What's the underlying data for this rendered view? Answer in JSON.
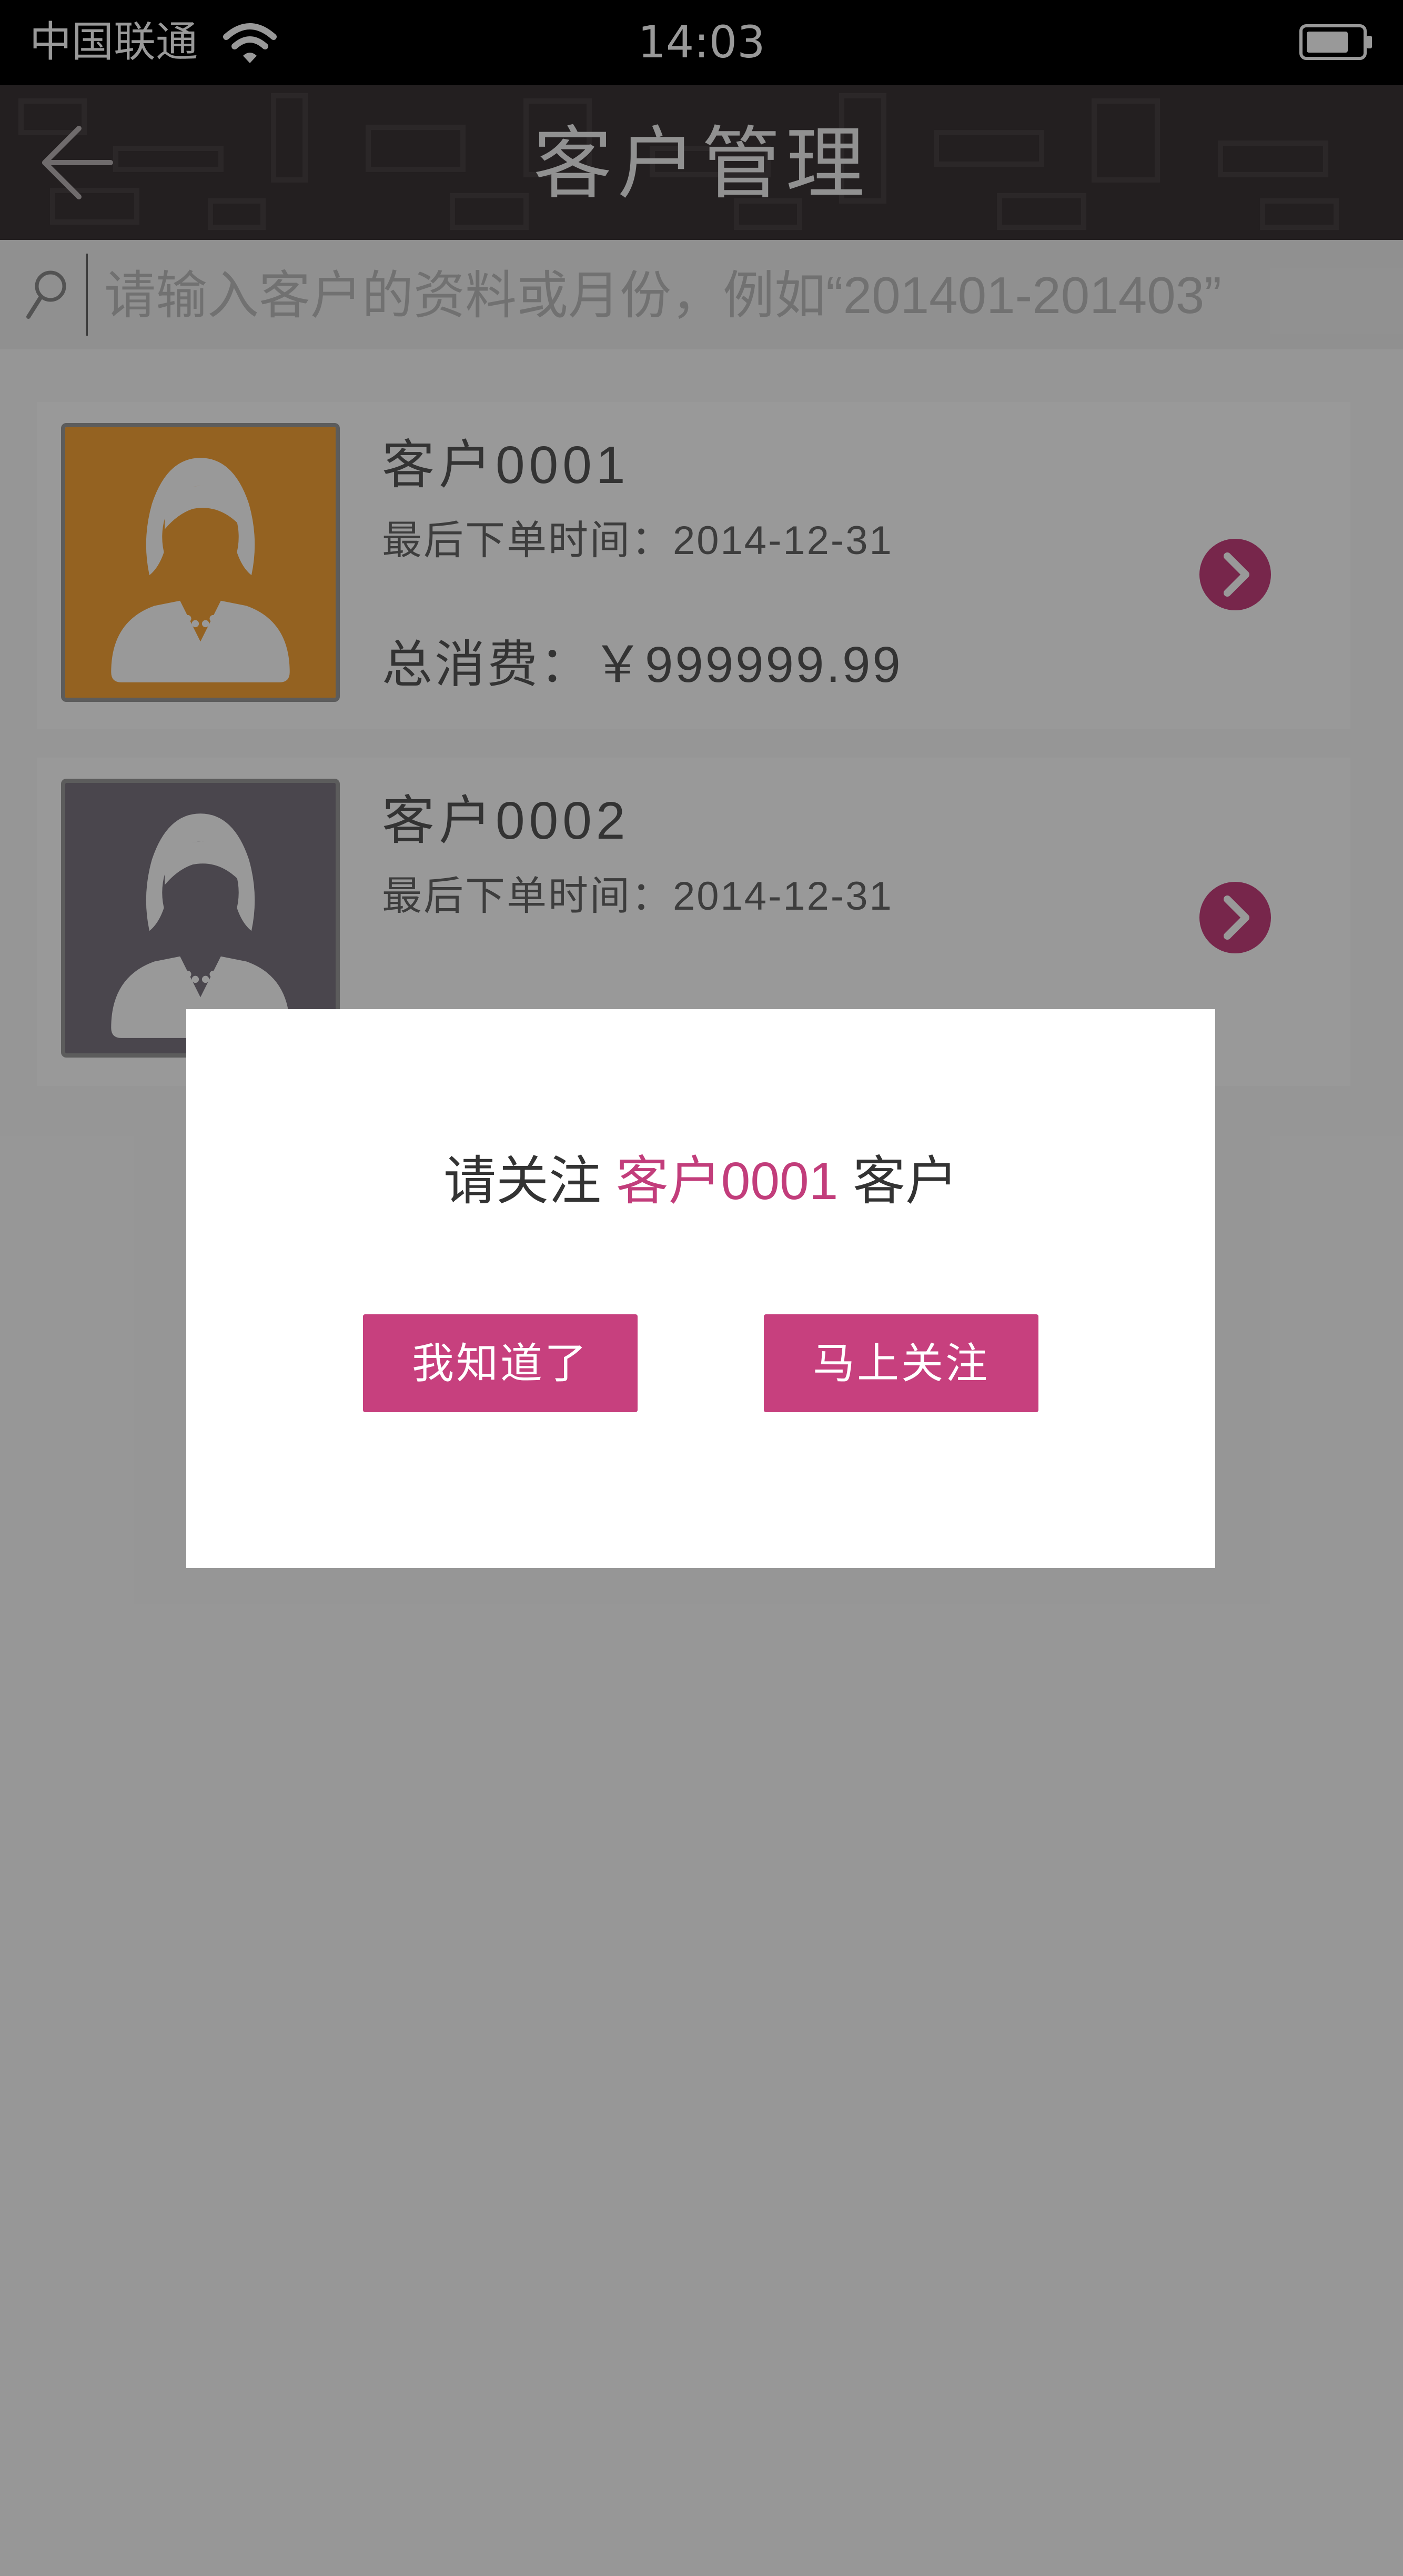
{
  "status_bar": {
    "carrier": "中国联通",
    "time": "14:03"
  },
  "header": {
    "title": "客户管理"
  },
  "search": {
    "placeholder": "请输入客户的资料或月份，例如“201401-201403”"
  },
  "customers": [
    {
      "name": "客户0001",
      "last_order": "最后下单时间：2014-12-31",
      "total_spend": "总消费：￥999999.99",
      "avatar_color": "#f7a338"
    },
    {
      "name": "客户0002",
      "last_order": "最后下单时间：2014-12-31",
      "avatar_color": "#7c7681"
    }
  ],
  "dialog": {
    "message_prefix": "请关注",
    "message_highlight": "客户0001",
    "message_suffix": "客户",
    "ok_button": "我知道了",
    "follow_button": "马上关注"
  },
  "colors": {
    "accent": "#c7407e",
    "header_bg": "#3b3536"
  },
  "icons": {
    "back": "arrow-left-icon",
    "search": "search-icon",
    "wifi": "wifi-icon",
    "battery": "battery-icon",
    "chevron": "chevron-right-icon",
    "avatar": "female-avatar-icon"
  }
}
